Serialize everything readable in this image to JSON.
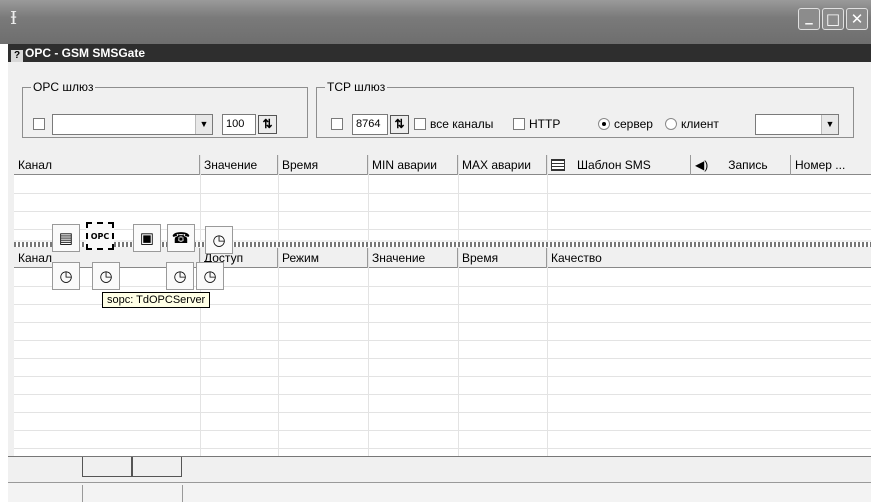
{
  "window": {
    "app_icon": "app-icon",
    "minimize_glyph": "_",
    "maximize_glyph": "□",
    "close_glyph": "✕"
  },
  "document": {
    "title": "OPC - GSM SMSGate",
    "title_icon": "?"
  },
  "opc_group": {
    "legend": "OPC шлюз",
    "combo_value": "",
    "spin_value": "100"
  },
  "tcp_group": {
    "legend": "TCP шлюз",
    "port_value": "8764",
    "all_channels_label": "все каналы",
    "http_label": "HTTP",
    "server_label": "сервер",
    "client_label": "клиент",
    "selected_mode": "сервер",
    "client_combo_value": ""
  },
  "top_grid": {
    "columns": [
      "Канал",
      "Значение",
      "Время",
      "MIN аварии",
      "MAX аварии",
      "Шаблон SMS",
      "Запись",
      "Номер ..."
    ],
    "rows": [],
    "sms_column_icon": "sms-template-icon",
    "record_column_icon": "speaker-icon"
  },
  "bottom_grid": {
    "columns": [
      "Канал",
      "Доступ",
      "Режим",
      "Значение",
      "Время",
      "Качество"
    ],
    "rows": []
  },
  "components": {
    "opc_tag": "OPC",
    "tooltip": "sopc: TdOPCServer",
    "icons": [
      "cards-icon",
      "opc-server-icon",
      "serial-port-icon",
      "modem-icon",
      "timer-icon",
      "timer-icon",
      "timer-icon",
      "timer-icon",
      "timer-icon"
    ]
  },
  "tabs": [
    "",
    ""
  ],
  "status": [
    "",
    ""
  ]
}
